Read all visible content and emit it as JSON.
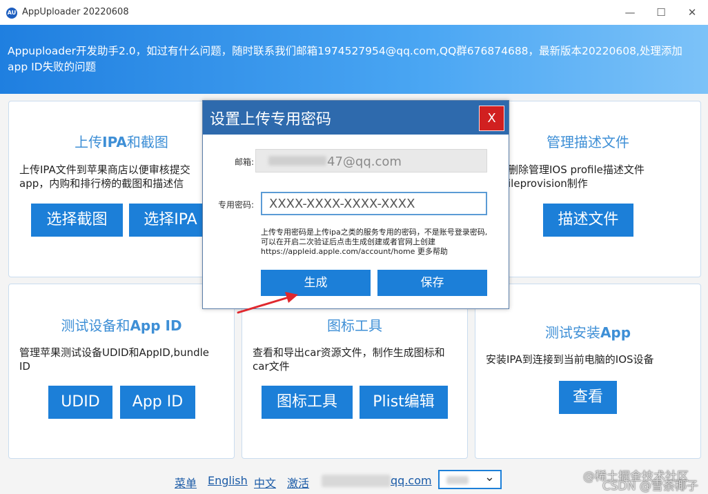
{
  "window": {
    "title": "AppUploader 20220608",
    "icon_text": "AU",
    "minimize": "—",
    "maximize": "☐",
    "close": "✕"
  },
  "banner": {
    "text": "Appuploader开发助手2.0，如过有什么问题，随时联系我们邮箱1974527954@qq.com,QQ群676874688，最新版本20220608,处理添加app ID失败的问题"
  },
  "cards": {
    "upload": {
      "title_pre": "上传",
      "title_bold": "IPA",
      "title_post": "和截图",
      "desc": "上传IPA文件到苹果商店以便审核提交app，内购和排行榜的截图和描述信",
      "btn1": "选择截图",
      "btn2": "选择IPA"
    },
    "profile": {
      "title": "管理描述文件",
      "desc": "删除管理IOS profile描述文件ileprovision制作",
      "btn": "描述文件"
    },
    "devices": {
      "title_pre": "测试设备和",
      "title_bold": "App ID",
      "desc": "管理苹果测试设备UDID和AppID,bundle ID",
      "btn1": "UDID",
      "btn2": "App ID"
    },
    "icons": {
      "title": "图标工具",
      "desc": "查看和导出car资源文件，制作生成图标和car文件",
      "btn1": "图标工具",
      "btn2": "Plist编辑"
    },
    "install": {
      "title_pre": "测试安装",
      "title_bold": "App",
      "desc": "安装IPA到连接到当前电脑的IOS设备",
      "btn": "查看"
    }
  },
  "footer": {
    "menu": "菜单",
    "english": "English",
    "chinese": "中文",
    "activate": "激活",
    "email_suffix": "qq.com",
    "chevron": "⌄"
  },
  "watermark": {
    "line1": "@稀土掘金技术社区",
    "line2": "CSDN @雪荼椰子"
  },
  "modal": {
    "title": "设置上传专用密码",
    "close": "X",
    "email_label": "邮箱:",
    "email_value": "47@qq.com",
    "password_label": "专用密码:",
    "password_placeholder": "XXXX-XXXX-XXXX-XXXX",
    "hint": "上传专用密码是上传ipa之类的服务专用的密码，不是账号登录密码,可以在开启二次验证后点击生成创建或者官网上创建https://appleid.apple.com/account/home 更多帮助",
    "generate": "生成",
    "save": "保存"
  },
  "colors": {
    "accent": "#1c7fd8",
    "modal_header": "#2e6aad",
    "close_red": "#d12020",
    "arrow_red": "#e0282e"
  }
}
